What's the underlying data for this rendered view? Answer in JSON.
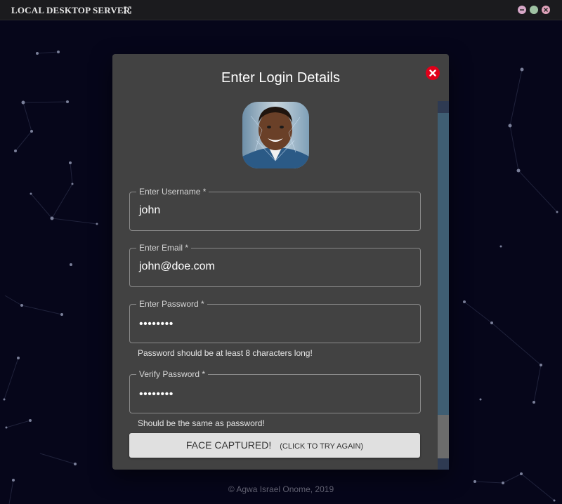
{
  "window": {
    "title": "LOCAL DESKTOP SERVER"
  },
  "modal": {
    "title": "Enter Login Details",
    "fields": {
      "username": {
        "label": "Enter Username *",
        "value": "john"
      },
      "email": {
        "label": "Enter Email *",
        "value": "john@doe.com"
      },
      "password": {
        "label": "Enter Password *",
        "value": "••••••••",
        "helper": "Password should be at least 8 characters long!"
      },
      "verify": {
        "label": "Verify Password *",
        "value": "••••••••",
        "helper": "Should be the same as password!"
      }
    },
    "face_button": {
      "label": "FACE CAPTURED!",
      "sub_label": "(CLICK TO TRY AGAIN)"
    }
  },
  "footer": {
    "text": "© Agwa Israel Onome, 2019"
  },
  "colors": {
    "background": "#06061a",
    "modal": "#424242",
    "close": "#e0001a",
    "button": "#e0e0e0"
  },
  "icons": [
    "expand-icon",
    "minimize-icon",
    "maximize-icon",
    "window-close-icon",
    "modal-close-icon"
  ]
}
